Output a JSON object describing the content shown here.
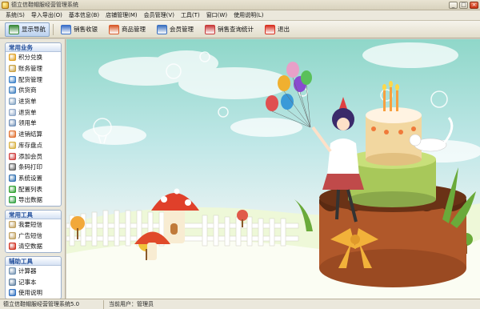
{
  "window": {
    "title": "德立信鞋帽服经营管理系统",
    "minimize": "_",
    "maximize": "□",
    "close": "×"
  },
  "menu": [
    {
      "label": "系统(S)"
    },
    {
      "label": "导入导出(O)"
    },
    {
      "label": "基本信息(B)"
    },
    {
      "label": "店铺管理(M)"
    },
    {
      "label": "会员管理(V)"
    },
    {
      "label": "工具(T)"
    },
    {
      "label": "窗口(W)"
    },
    {
      "label": "使用说明(L)"
    }
  ],
  "toolbar": [
    {
      "label": "显示导航",
      "icon": "navigation-icon",
      "color": "#3a8a3a",
      "active": true
    },
    {
      "label": "销售收银",
      "icon": "cashier-icon",
      "color": "#3a6fc8"
    },
    {
      "label": "商品管理",
      "icon": "goods-icon",
      "color": "#d85a2a"
    },
    {
      "label": "会员管理",
      "icon": "member-icon",
      "color": "#3a70c0"
    },
    {
      "label": "销售查询统计",
      "icon": "stats-icon",
      "color": "#c83a3a"
    },
    {
      "label": "退出",
      "icon": "exit-icon",
      "color": "#d83020"
    }
  ],
  "sidebar": {
    "groups": [
      {
        "title": "常用业务",
        "items": [
          {
            "label": "积分兑换",
            "icon": "points-icon",
            "color": "#e0a020"
          },
          {
            "label": "账务管理",
            "icon": "account-icon",
            "color": "#c8a040"
          },
          {
            "label": "配货管理",
            "icon": "distribution-icon",
            "color": "#3a80c8"
          },
          {
            "label": "供货商",
            "icon": "supplier-icon",
            "color": "#4080c0"
          },
          {
            "label": "进货单",
            "icon": "purchase-icon",
            "color": "#80a0c0"
          },
          {
            "label": "退货单",
            "icon": "return-icon",
            "color": "#90a8c8"
          },
          {
            "label": "领用单",
            "icon": "requisition-icon",
            "color": "#7090b8"
          },
          {
            "label": "进销结算",
            "icon": "settlement-icon",
            "color": "#e07030"
          },
          {
            "label": "库存盘点",
            "icon": "inventory-icon",
            "color": "#d8b040"
          },
          {
            "label": "添加会员",
            "icon": "add-member-icon",
            "color": "#d04040"
          },
          {
            "label": "条码打印",
            "icon": "barcode-icon",
            "color": "#606060"
          },
          {
            "label": "系统设置",
            "icon": "settings-icon",
            "color": "#3070b0"
          },
          {
            "label": "配置列表",
            "icon": "config-icon",
            "color": "#30a030"
          },
          {
            "label": "导出数据",
            "icon": "export-icon",
            "color": "#30a040"
          }
        ]
      },
      {
        "title": "常用工具",
        "items": [
          {
            "label": "我要短信",
            "icon": "sms-icon",
            "color": "#c0a060"
          },
          {
            "label": "广告短信",
            "icon": "ad-sms-icon",
            "color": "#c0a060"
          },
          {
            "label": "清空数据",
            "icon": "clear-icon",
            "color": "#d03020"
          }
        ]
      },
      {
        "title": "辅助工具",
        "items": [
          {
            "label": "计算器",
            "icon": "calculator-icon",
            "color": "#7090b0"
          },
          {
            "label": "记事本",
            "icon": "notepad-icon",
            "color": "#6080a0"
          },
          {
            "label": "使用说明",
            "icon": "help-icon",
            "color": "#3070c0"
          }
        ]
      }
    ]
  },
  "status": {
    "version": "德立信鞋帽服经营管理系统5.0",
    "current_user": "当前用户：管理员"
  }
}
